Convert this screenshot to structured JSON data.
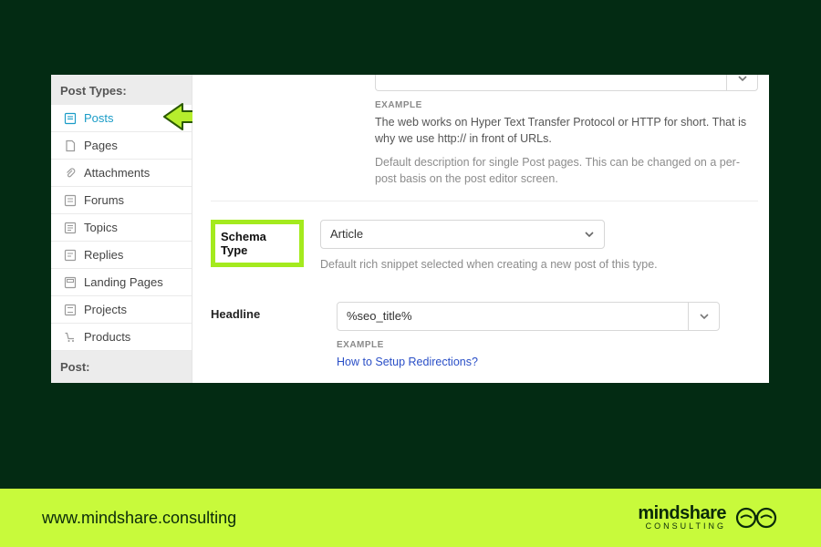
{
  "colors": {
    "accent": "#a4ea1e",
    "footer_bg": "#c8fa3b",
    "link": "#2a4fc7",
    "active": "#1a9cc7"
  },
  "sidebar": {
    "header": "Post Types:",
    "items": [
      {
        "label": "Posts",
        "icon": "post-icon",
        "active": true
      },
      {
        "label": "Pages",
        "icon": "page-icon"
      },
      {
        "label": "Attachments",
        "icon": "attachment-icon"
      },
      {
        "label": "Forums",
        "icon": "forum-icon"
      },
      {
        "label": "Topics",
        "icon": "topic-icon"
      },
      {
        "label": "Replies",
        "icon": "reply-icon"
      },
      {
        "label": "Landing Pages",
        "icon": "landing-icon"
      },
      {
        "label": "Projects",
        "icon": "project-icon"
      },
      {
        "label": "Products",
        "icon": "cart-icon"
      }
    ],
    "footer": "Post:"
  },
  "top_field": {
    "example_label": "EXAMPLE",
    "example_text": "The web works on Hyper Text Transfer Protocol or HTTP for short. That is why we use http:// in front of URLs.",
    "help_text": "Default description for single Post pages. This can be changed on a per-post basis on the post editor screen."
  },
  "schema": {
    "label": "Schema Type",
    "value": "Article",
    "help": "Default rich snippet selected when creating a new post of this type."
  },
  "headline": {
    "label": "Headline",
    "value": "%seo_title%",
    "example_label": "EXAMPLE",
    "example_link": "How to Setup Redirections?"
  },
  "footer": {
    "url": "www.mindshare.consulting",
    "brand_line1": "mindshare",
    "brand_line2": "CONSULTING"
  }
}
